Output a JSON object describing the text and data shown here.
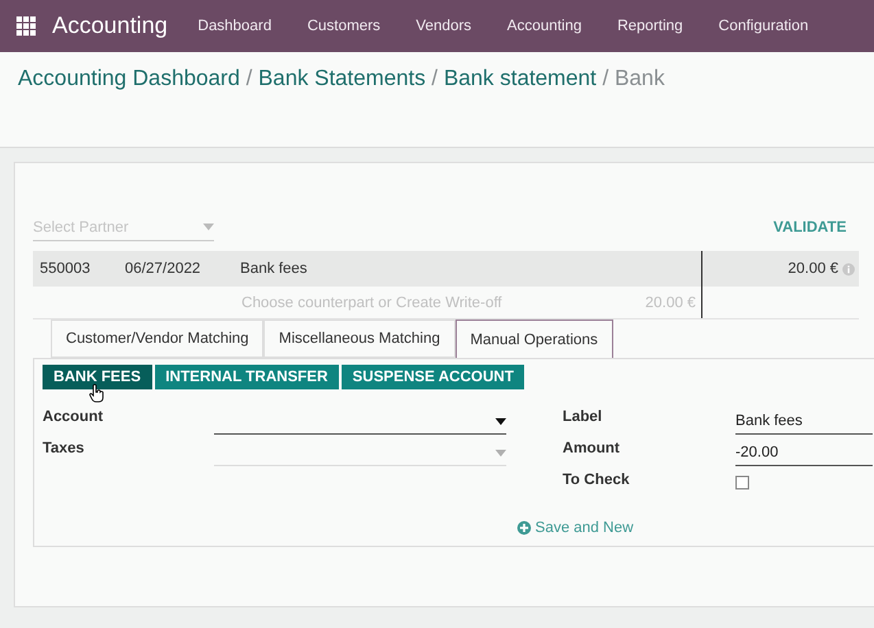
{
  "navbar": {
    "app_title": "Accounting",
    "menu": [
      "Dashboard",
      "Customers",
      "Vendors",
      "Accounting",
      "Reporting",
      "Configuration"
    ]
  },
  "breadcrumb": {
    "separator": "/",
    "links": [
      "Accounting Dashboard",
      "Bank Statements",
      "Bank statement"
    ],
    "current": "Bank"
  },
  "partner": {
    "placeholder": "Select Partner"
  },
  "validate": "VALIDATE",
  "statement_line": {
    "reference": "550003",
    "date": "06/27/2022",
    "label": "Bank fees",
    "amount": "20.00 €"
  },
  "counterpart": {
    "hint": "Choose counterpart or Create Write-off",
    "amount": "20.00 €"
  },
  "tabs": [
    {
      "label": "Customer/Vendor Matching",
      "selected": false
    },
    {
      "label": "Miscellaneous Matching",
      "selected": false
    },
    {
      "label": "Manual Operations",
      "selected": true
    }
  ],
  "models": [
    {
      "label": "BANK FEES",
      "selected": true
    },
    {
      "label": "INTERNAL TRANSFER",
      "selected": false
    },
    {
      "label": "SUSPENSE ACCOUNT",
      "selected": false
    }
  ],
  "left_fields": [
    {
      "label": "Account",
      "disabled": false
    },
    {
      "label": "Taxes",
      "disabled": true
    }
  ],
  "right_fields": [
    {
      "label": "Label",
      "value": "Bank fees"
    },
    {
      "label": "Amount",
      "value": "-20.00"
    }
  ],
  "to_check": {
    "label": "To Check",
    "checked": false
  },
  "save_and_new": "Save and New"
}
